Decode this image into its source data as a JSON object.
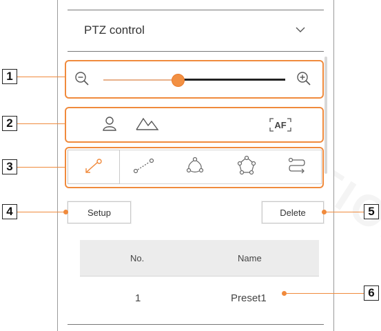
{
  "panel": {
    "title": "PTZ control"
  },
  "zoom": {
    "level": 0.41
  },
  "focus_tools": {
    "af_label": "AF"
  },
  "buttons": {
    "setup": "Setup",
    "delete": "Delete"
  },
  "table": {
    "columns": [
      "No.",
      "Name"
    ],
    "rows": [
      {
        "no": "1",
        "name": "Preset1"
      }
    ]
  },
  "callouts": [
    "1",
    "2",
    "3",
    "4",
    "5",
    "6"
  ],
  "colors": {
    "highlight": "#f08a3c",
    "slider_knob": "#f29043"
  },
  "icons": [
    "zoom-out-icon",
    "zoom-in-icon",
    "person-icon",
    "mountain-icon",
    "af-icon",
    "preset-icon",
    "swing-icon",
    "group-icon",
    "tour-icon",
    "trace-icon",
    "chevron-down-icon"
  ]
}
